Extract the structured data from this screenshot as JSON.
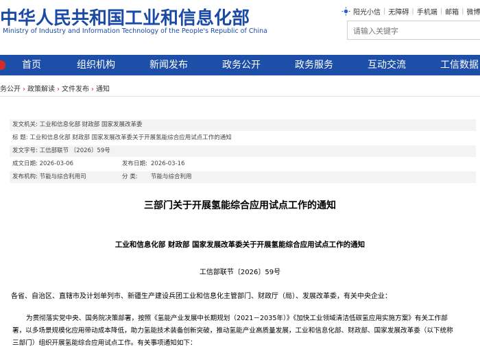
{
  "header": {
    "title": "中华人民共和国工业和信息化部",
    "subtitle": "Ministry of Industry and Information Technology of the People's Republic of China",
    "utils": [
      "阳光小信",
      "无障碍",
      "手机端",
      "邮箱",
      "微博"
    ],
    "search_placeholder": "请输入关键字"
  },
  "nav": {
    "items": [
      "首页",
      "组织机构",
      "新闻发布",
      "政务公开",
      "政务服务",
      "互动交流",
      "工信数据"
    ]
  },
  "breadcrumb": [
    "务公开",
    "政策解读",
    "文件发布",
    "通知"
  ],
  "info": {
    "issuer_label": "发文机关:",
    "issuer_value": "工业和信息化部  财政部  国家发展改革委",
    "title_label": "标      题:",
    "title_value": "工业和信息化部 财政部 国家发展改革委关于开展氢能综合应用试点工作的通知",
    "docno_label": "发文字号:",
    "docno_value": "工信部联节 〔2026〕59号",
    "date_label": "成文日期:",
    "date_value": "2026-03-06",
    "pub_label": "发布日期:",
    "pub_value": "2026-03-16",
    "org_label": "发布机构:",
    "org_value": "节能与综合利用司",
    "cat_label": "分      类:",
    "cat_value": "节能与综合利用"
  },
  "article": {
    "title": "三部门关于开展氢能综合应用试点工作的通知",
    "subtitle": "工业和信息化部  财政部  国家发展改革委关于开展氢能综合应用试点工作的通知",
    "doc_number": "工信部联节〔2026〕59号",
    "addressee": "各省、自治区、直辖市及计划单列市、新疆生产建设兵团工业和信息化主管部门、财政厅（局）、发展改革委，有关中央企业：",
    "para_line1": "为贯彻落实党中央、国务院决策部署，按照《氢能产业发展中长期规划（2021－2035年）》《加快工业领域清洁低碳氢应用实施方案》有关工作部",
    "para_line2": "署，以多场景规模化应用带动成本降低，助力氢能技术装备创新突破，推动氢能产业高质量发展，工业和信息化部、财政部、国家发展改革委（以下统称",
    "para_line3": "三部门）组织开展氢能综合应用试点工作。有关事项通知如下："
  },
  "colors": {
    "brand_blue": "#1d4fa8",
    "accent_red": "#d72b2b"
  }
}
